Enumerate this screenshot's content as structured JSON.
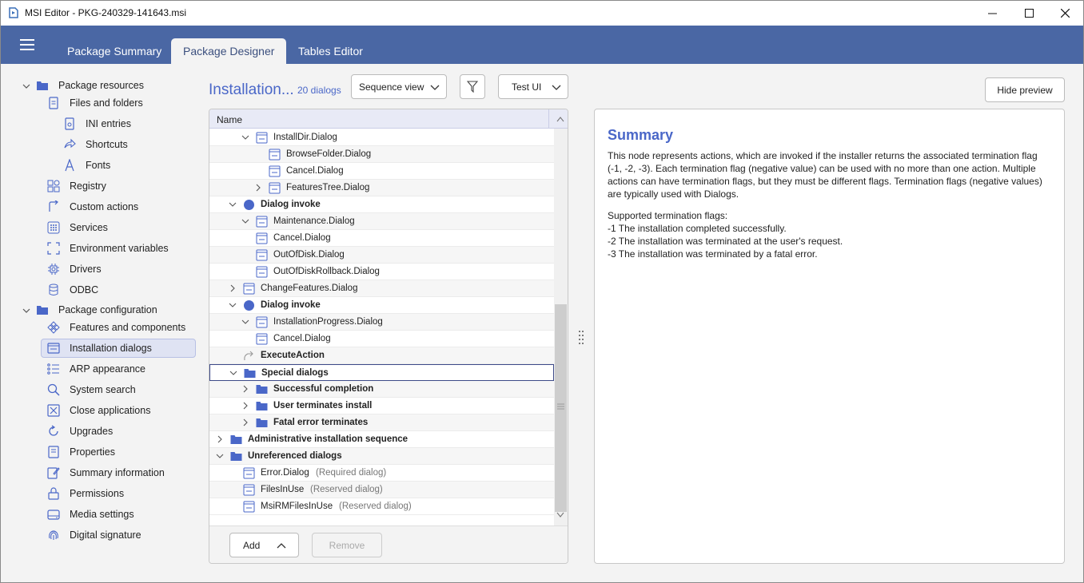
{
  "window": {
    "title": "MSI Editor - PKG-240329-141643.msi",
    "controls": [
      "minimize",
      "maximize",
      "close"
    ]
  },
  "ribbon": {
    "tabs": [
      {
        "label": "Package Summary",
        "active": false
      },
      {
        "label": "Package Designer",
        "active": true
      },
      {
        "label": "Tables Editor",
        "active": false
      }
    ]
  },
  "sidebar": {
    "groups": [
      {
        "label": "Package resources",
        "items": [
          {
            "label": "Files and folders",
            "icon": "file-icon"
          },
          {
            "label": "INI entries",
            "icon": "ini-file-icon"
          },
          {
            "label": "Shortcuts",
            "icon": "shortcut-arrow-icon"
          },
          {
            "label": "Fonts",
            "icon": "font-icon"
          },
          {
            "label": "Registry",
            "icon": "registry-icon"
          },
          {
            "label": "Custom actions",
            "icon": "custom-action-icon"
          },
          {
            "label": "Services",
            "icon": "services-icon"
          },
          {
            "label": "Environment variables",
            "icon": "environment-variables-icon"
          },
          {
            "label": "Drivers",
            "icon": "chip-icon"
          },
          {
            "label": "ODBC",
            "icon": "database-icon"
          }
        ]
      },
      {
        "label": "Package configuration",
        "items": [
          {
            "label": "Features and components",
            "icon": "features-icon"
          },
          {
            "label": "Installation dialogs",
            "icon": "dialog-icon",
            "selected": true
          },
          {
            "label": "ARP appearance",
            "icon": "list-icon"
          },
          {
            "label": "System search",
            "icon": "search-icon"
          },
          {
            "label": "Close applications",
            "icon": "close-box-icon"
          },
          {
            "label": "Upgrades",
            "icon": "upgrade-icon"
          },
          {
            "label": "Properties",
            "icon": "properties-icon"
          },
          {
            "label": "Summary information",
            "icon": "edit-document-icon"
          },
          {
            "label": "Permissions",
            "icon": "lock-icon"
          },
          {
            "label": "Media settings",
            "icon": "disk-icon"
          },
          {
            "label": "Digital signature",
            "icon": "fingerprint-icon"
          }
        ]
      }
    ]
  },
  "center": {
    "title": "Installation...",
    "count": "20 dialogs",
    "view_dropdown": "Sequence view",
    "test_ui_label": "Test UI",
    "hide_preview_label": "Hide preview",
    "column_header": "Name",
    "add_label": "Add",
    "remove_label": "Remove",
    "rows": [
      {
        "indent": 3,
        "chevron": "down",
        "icon": "dialog",
        "text": "InstallDir.Dialog"
      },
      {
        "indent": 4,
        "chevron": "",
        "icon": "dialog",
        "text": "BrowseFolder.Dialog"
      },
      {
        "indent": 4,
        "chevron": "",
        "icon": "dialog",
        "text": "Cancel.Dialog"
      },
      {
        "indent": 4,
        "chevron": "right",
        "icon": "dialog",
        "text": "FeaturesTree.Dialog"
      },
      {
        "indent": 2,
        "chevron": "down",
        "icon": "circle",
        "text": "Dialog invoke",
        "bold": true
      },
      {
        "indent": 3,
        "chevron": "down",
        "icon": "dialog",
        "text": "Maintenance.Dialog"
      },
      {
        "indent": 4,
        "chevron": "",
        "icon": "dialog",
        "text": "Cancel.Dialog",
        "shift": -16
      },
      {
        "indent": 4,
        "chevron": "",
        "icon": "dialog",
        "text": "OutOfDisk.Dialog",
        "shift": -16
      },
      {
        "indent": 4,
        "chevron": "",
        "icon": "dialog",
        "text": "OutOfDiskRollback.Dialog",
        "shift": -16
      },
      {
        "indent": 3,
        "chevron": "right",
        "icon": "dialog",
        "text": "ChangeFeatures.Dialog",
        "shift": -16
      },
      {
        "indent": 2,
        "chevron": "down",
        "icon": "circle",
        "text": "Dialog invoke",
        "bold": true
      },
      {
        "indent": 3,
        "chevron": "down",
        "icon": "dialog",
        "text": "InstallationProgress.Dialog"
      },
      {
        "indent": 4,
        "chevron": "",
        "icon": "dialog",
        "text": "Cancel.Dialog",
        "shift": -16
      },
      {
        "indent": 2,
        "chevron": "",
        "icon": "action",
        "text": "ExecuteAction",
        "bold": true
      },
      {
        "indent": 2,
        "chevron": "down",
        "icon": "folder",
        "text": "Special dialogs",
        "bold": true,
        "selected": true
      },
      {
        "indent": 3,
        "chevron": "right",
        "icon": "folder",
        "text": "Successful completion",
        "bold": true
      },
      {
        "indent": 3,
        "chevron": "right",
        "icon": "folder",
        "text": "User terminates install",
        "bold": true
      },
      {
        "indent": 3,
        "chevron": "right",
        "icon": "folder",
        "text": "Fatal error terminates",
        "bold": true
      },
      {
        "indent": 1,
        "chevron": "right",
        "icon": "folder",
        "text": "Administrative installation sequence",
        "bold": true
      },
      {
        "indent": 1,
        "chevron": "down",
        "icon": "folder",
        "text": "Unreferenced dialogs",
        "bold": true
      },
      {
        "indent": 2,
        "chevron": "",
        "icon": "dialog",
        "text": "Error.Dialog",
        "note": "(Required dialog)"
      },
      {
        "indent": 2,
        "chevron": "",
        "icon": "dialog",
        "text": "FilesInUse",
        "note": "(Reserved dialog)"
      },
      {
        "indent": 2,
        "chevron": "",
        "icon": "dialog",
        "text": "MsiRMFilesInUse",
        "note": "(Reserved dialog)"
      }
    ]
  },
  "preview": {
    "title": "Summary",
    "paragraph1": "This node represents actions, which are invoked if the installer returns the associated termination flag (-1, -2, -3). Each termination flag (negative value) can be used with no more than one action. Multiple actions can have termination flags, but they must be different flags. Termination flags (negative values) are typically used with Dialogs.",
    "flags_heading": "Supported termination flags:",
    "flags": [
      "-1  The installation completed successfully.",
      "-2  The installation was terminated at the user's request.",
      "-3  The installation was terminated by a fatal error."
    ]
  },
  "colors": {
    "ribbon": "#4a67a4",
    "accent": "#4a67c8",
    "selected_bg": "#dfe3f3"
  }
}
